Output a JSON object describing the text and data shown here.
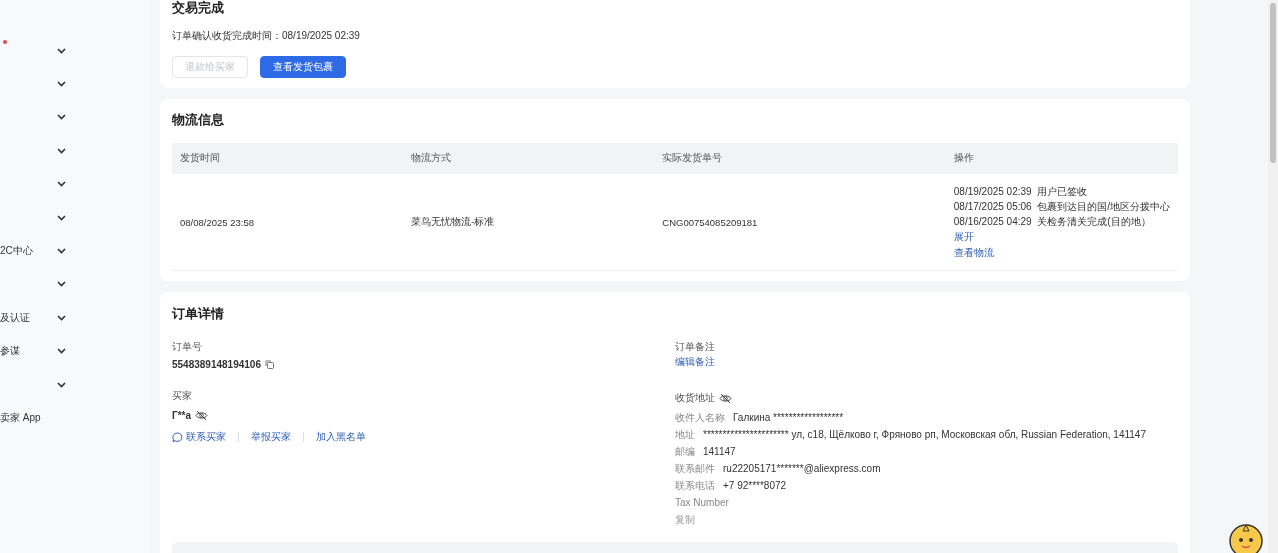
{
  "sidebar": {
    "items": [
      {
        "badge": true
      },
      {
        "badge": false
      },
      {
        "badge": false
      },
      {
        "badge": false
      },
      {
        "badge": false
      },
      {
        "badge": false
      },
      {
        "label": "2C中心",
        "badge": false
      },
      {
        "badge": false
      },
      {
        "label": "及认证",
        "badge": false
      },
      {
        "label": "参谋",
        "badge": false
      },
      {
        "badge": false
      }
    ],
    "app_link": "卖家 App"
  },
  "status_card": {
    "title": "交易完成",
    "confirm_text": "订单确认收货完成时间：08/19/2025 02:39",
    "buttons": [
      {
        "label": "退款给买家",
        "disabled": true
      },
      {
        "label": "查看发货包裹",
        "disabled": false
      }
    ]
  },
  "logistics": {
    "title": "物流信息",
    "columns": [
      "发货时间",
      "物流方式",
      "实际发货单号",
      "操作"
    ],
    "rows": [
      {
        "ship_time": "08/08/2025 23:58",
        "method": "菜鸟无忧物流-标准",
        "tracking_no": "CNG00754085209181",
        "events": [
          {
            "time": "08/19/2025 02:39",
            "text": "用户已签收"
          },
          {
            "time": "08/17/2025 05:06",
            "text": "包裹到达目的国/地区分拨中心"
          },
          {
            "time": "08/16/2025 04:29",
            "text": "关检务清关完成(目的地）"
          }
        ],
        "expand_link": "展开",
        "track_link": "查看物流"
      }
    ]
  },
  "order_details": {
    "title": "订单详情",
    "order_no_label": "订单号",
    "order_no": "5548389148194106",
    "remark_label": "订单备注",
    "remark_link": "编辑备注",
    "buyer_label": "买家",
    "buyer_name": "Г**а",
    "buyer_links": [
      "联系买家",
      "举报买家",
      "加入黑名单"
    ],
    "address_label": "收货地址",
    "address_fields": [
      {
        "label": "收件人名称",
        "value": "Галкина ******************"
      },
      {
        "label": "地址",
        "value": "********************** ул, с18, Щёлково г, Фряново рп, Московская обл, Russian Federation, 141147"
      },
      {
        "label": "邮编",
        "value": "141147"
      },
      {
        "label": "联系邮件",
        "value": "ru22205171*******@aliexpress.com"
      },
      {
        "label": "联系电话",
        "value": "+7 92****8072"
      },
      {
        "label": "Tax Number"
      }
    ],
    "copy_link": "复制"
  }
}
